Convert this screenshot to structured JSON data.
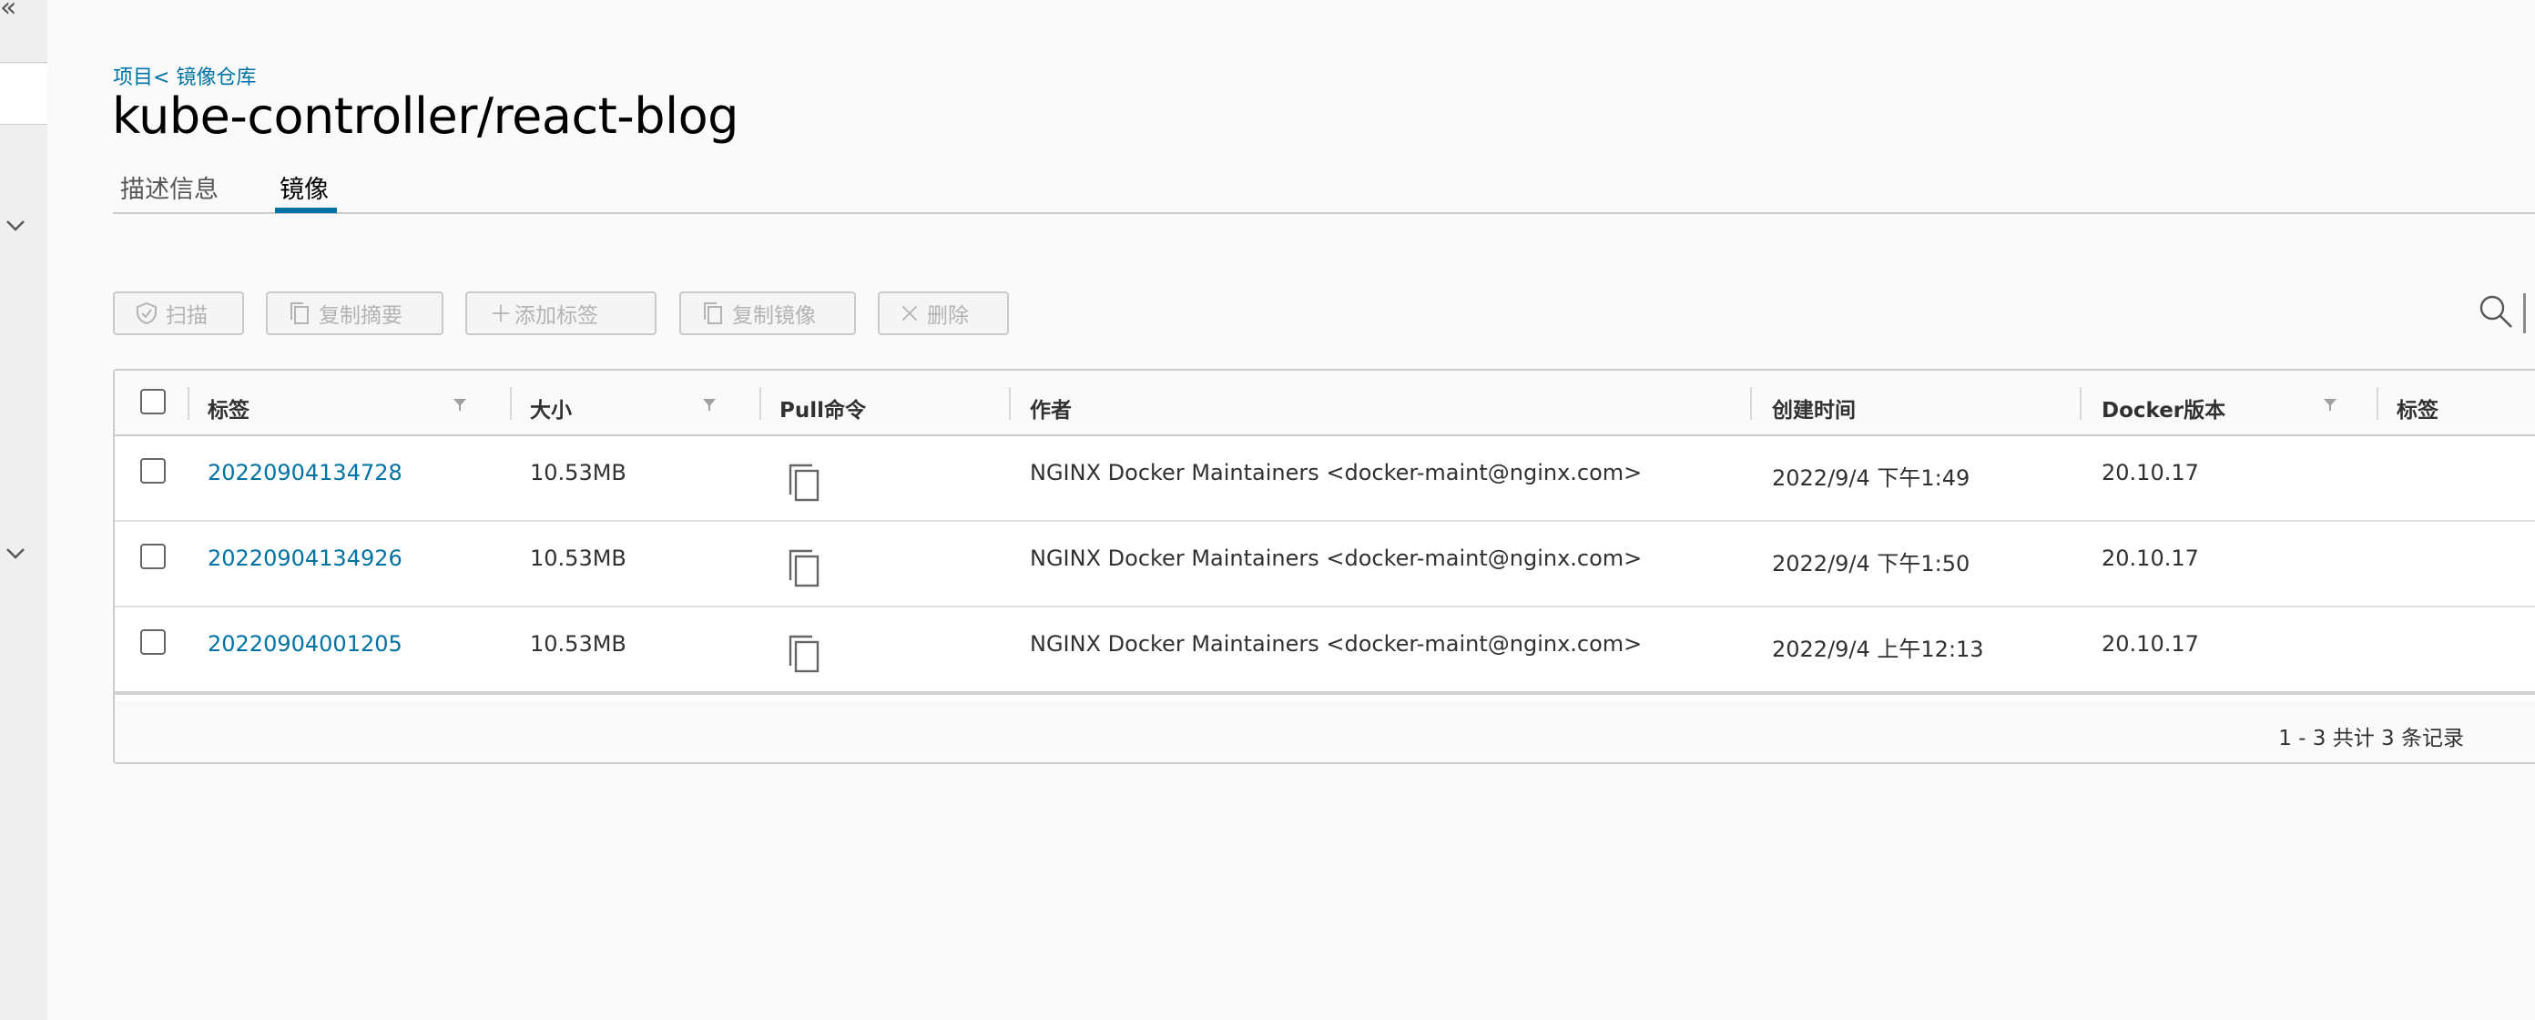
{
  "sidebar": {
    "collapse_glyph": "«"
  },
  "breadcrumb": {
    "project": "项目",
    "separator": "<",
    "repository": "镜像仓库"
  },
  "page": {
    "title": "kube-controller/react-blog"
  },
  "tabs": [
    {
      "label": "描述信息",
      "active": false
    },
    {
      "label": "镜像",
      "active": true
    }
  ],
  "toolbar": {
    "scan": "扫描",
    "copy_digest": "复制摘要",
    "add_label": "添加标签",
    "copy_image": "复制镜像",
    "delete": "删除"
  },
  "table": {
    "columns": [
      "标签",
      "大小",
      "Pull命令",
      "作者",
      "创建时间",
      "Docker版本",
      "标签"
    ],
    "rows": [
      {
        "tag": "20220904134728",
        "size": "10.53MB",
        "author": "NGINX Docker Maintainers <docker-maint@nginx.com>",
        "created": "2022/9/4 下午1:49",
        "docker_version": "20.10.17"
      },
      {
        "tag": "20220904134926",
        "size": "10.53MB",
        "author": "NGINX Docker Maintainers <docker-maint@nginx.com>",
        "created": "2022/9/4 下午1:50",
        "docker_version": "20.10.17"
      },
      {
        "tag": "20220904001205",
        "size": "10.53MB",
        "author": "NGINX Docker Maintainers <docker-maint@nginx.com>",
        "created": "2022/9/4 上午12:13",
        "docker_version": "20.10.17"
      }
    ],
    "footer": "1 - 3 共计 3 条记录"
  },
  "colors": {
    "link": "#0072a3",
    "text": "#313131",
    "disabled": "#b3b3b3",
    "border": "#cccccc"
  }
}
